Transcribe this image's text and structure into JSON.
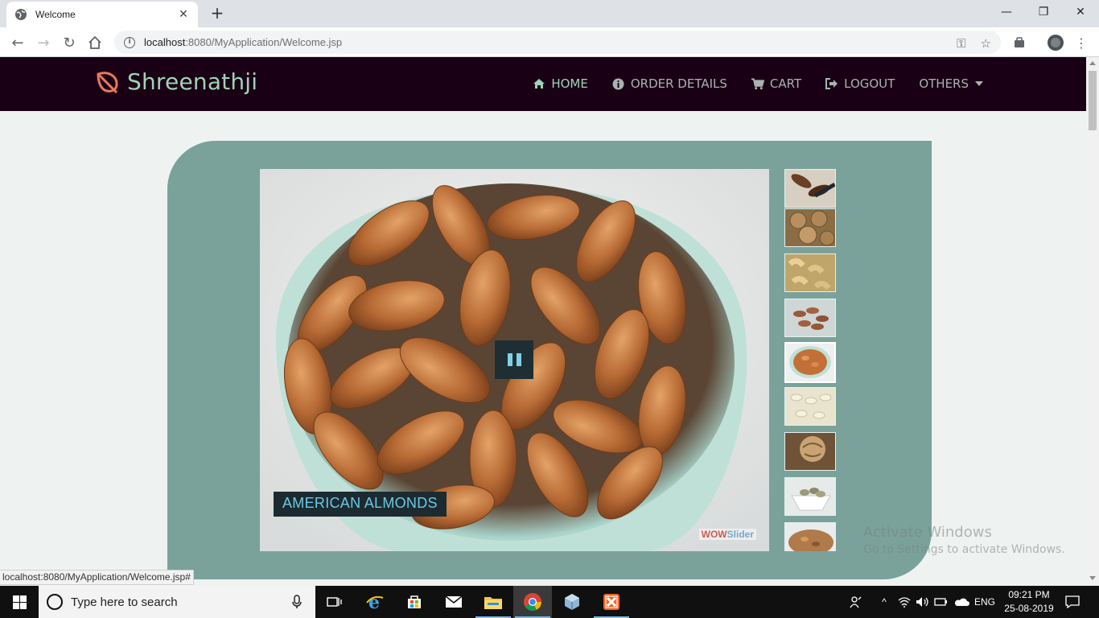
{
  "browser": {
    "tab_title": "Welcome",
    "url_host": "localhost",
    "url_path": ":8080/MyApplication/Welcome.jsp",
    "status_url": "localhost:8080/MyApplication/Welcome.jsp#"
  },
  "site": {
    "brand": "Shreenathji",
    "brand_icon": "leaf-icon",
    "menu": [
      {
        "label": "HOME",
        "icon": "home-icon",
        "active": true
      },
      {
        "label": "ORDER DETAILS",
        "icon": "info-icon"
      },
      {
        "label": "CART",
        "icon": "cart-icon"
      },
      {
        "label": "LOGOUT",
        "icon": "logout-icon"
      },
      {
        "label": "OTHERS",
        "icon": "caret-down-icon"
      }
    ]
  },
  "slider": {
    "caption": "AMERICAN ALMONDS",
    "brand_part1": "WOW",
    "brand_part2": "Slider",
    "active_thumb": 5,
    "thumb_count": 9
  },
  "watermark": {
    "line1": "Activate Windows",
    "line2": "Go to Settings to activate Windows."
  },
  "taskbar": {
    "search_placeholder": "Type here to search",
    "language": "ENG",
    "time": "09:21 PM",
    "date": "25-08-2019"
  },
  "colors": {
    "navbar_bg": "#1a0015",
    "brand_green": "#9fd3b6",
    "panel_teal": "#7aa29b",
    "caption_text": "#6ec8e4"
  }
}
